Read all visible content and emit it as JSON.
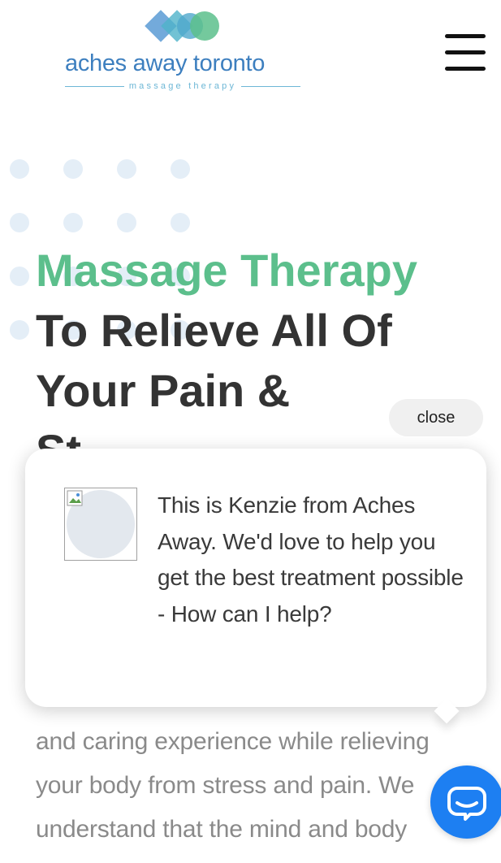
{
  "header": {
    "logo_name": "aches away toronto",
    "logo_tagline": "massage therapy",
    "logo_colors": [
      "#5b9bd5",
      "#4fb3c9",
      "#5cbf8c"
    ],
    "menu_icon": "hamburger-menu-icon"
  },
  "hero": {
    "title_accent": "Massage Therapy",
    "title_line1": "To Relieve All Of",
    "title_line2": "Your Pain &",
    "title_line3": "St",
    "body": "and caring experience while relieving your body from stress and pain. We understand that the mind and body"
  },
  "chat": {
    "close_label": "close",
    "message": "This is Kenzie from Aches Away. We'd love to help you get the best treatment possible - How can I help?",
    "avatar_icon": "broken-image-icon",
    "fab_icon": "chat-bubbles-icon",
    "fab_color": "#1d7ff2"
  },
  "colors": {
    "accent_green": "#5cbf8c",
    "heading_dark": "#333333",
    "body_gray": "#8a8a8a",
    "brand_blue": "#3d7fbf"
  }
}
